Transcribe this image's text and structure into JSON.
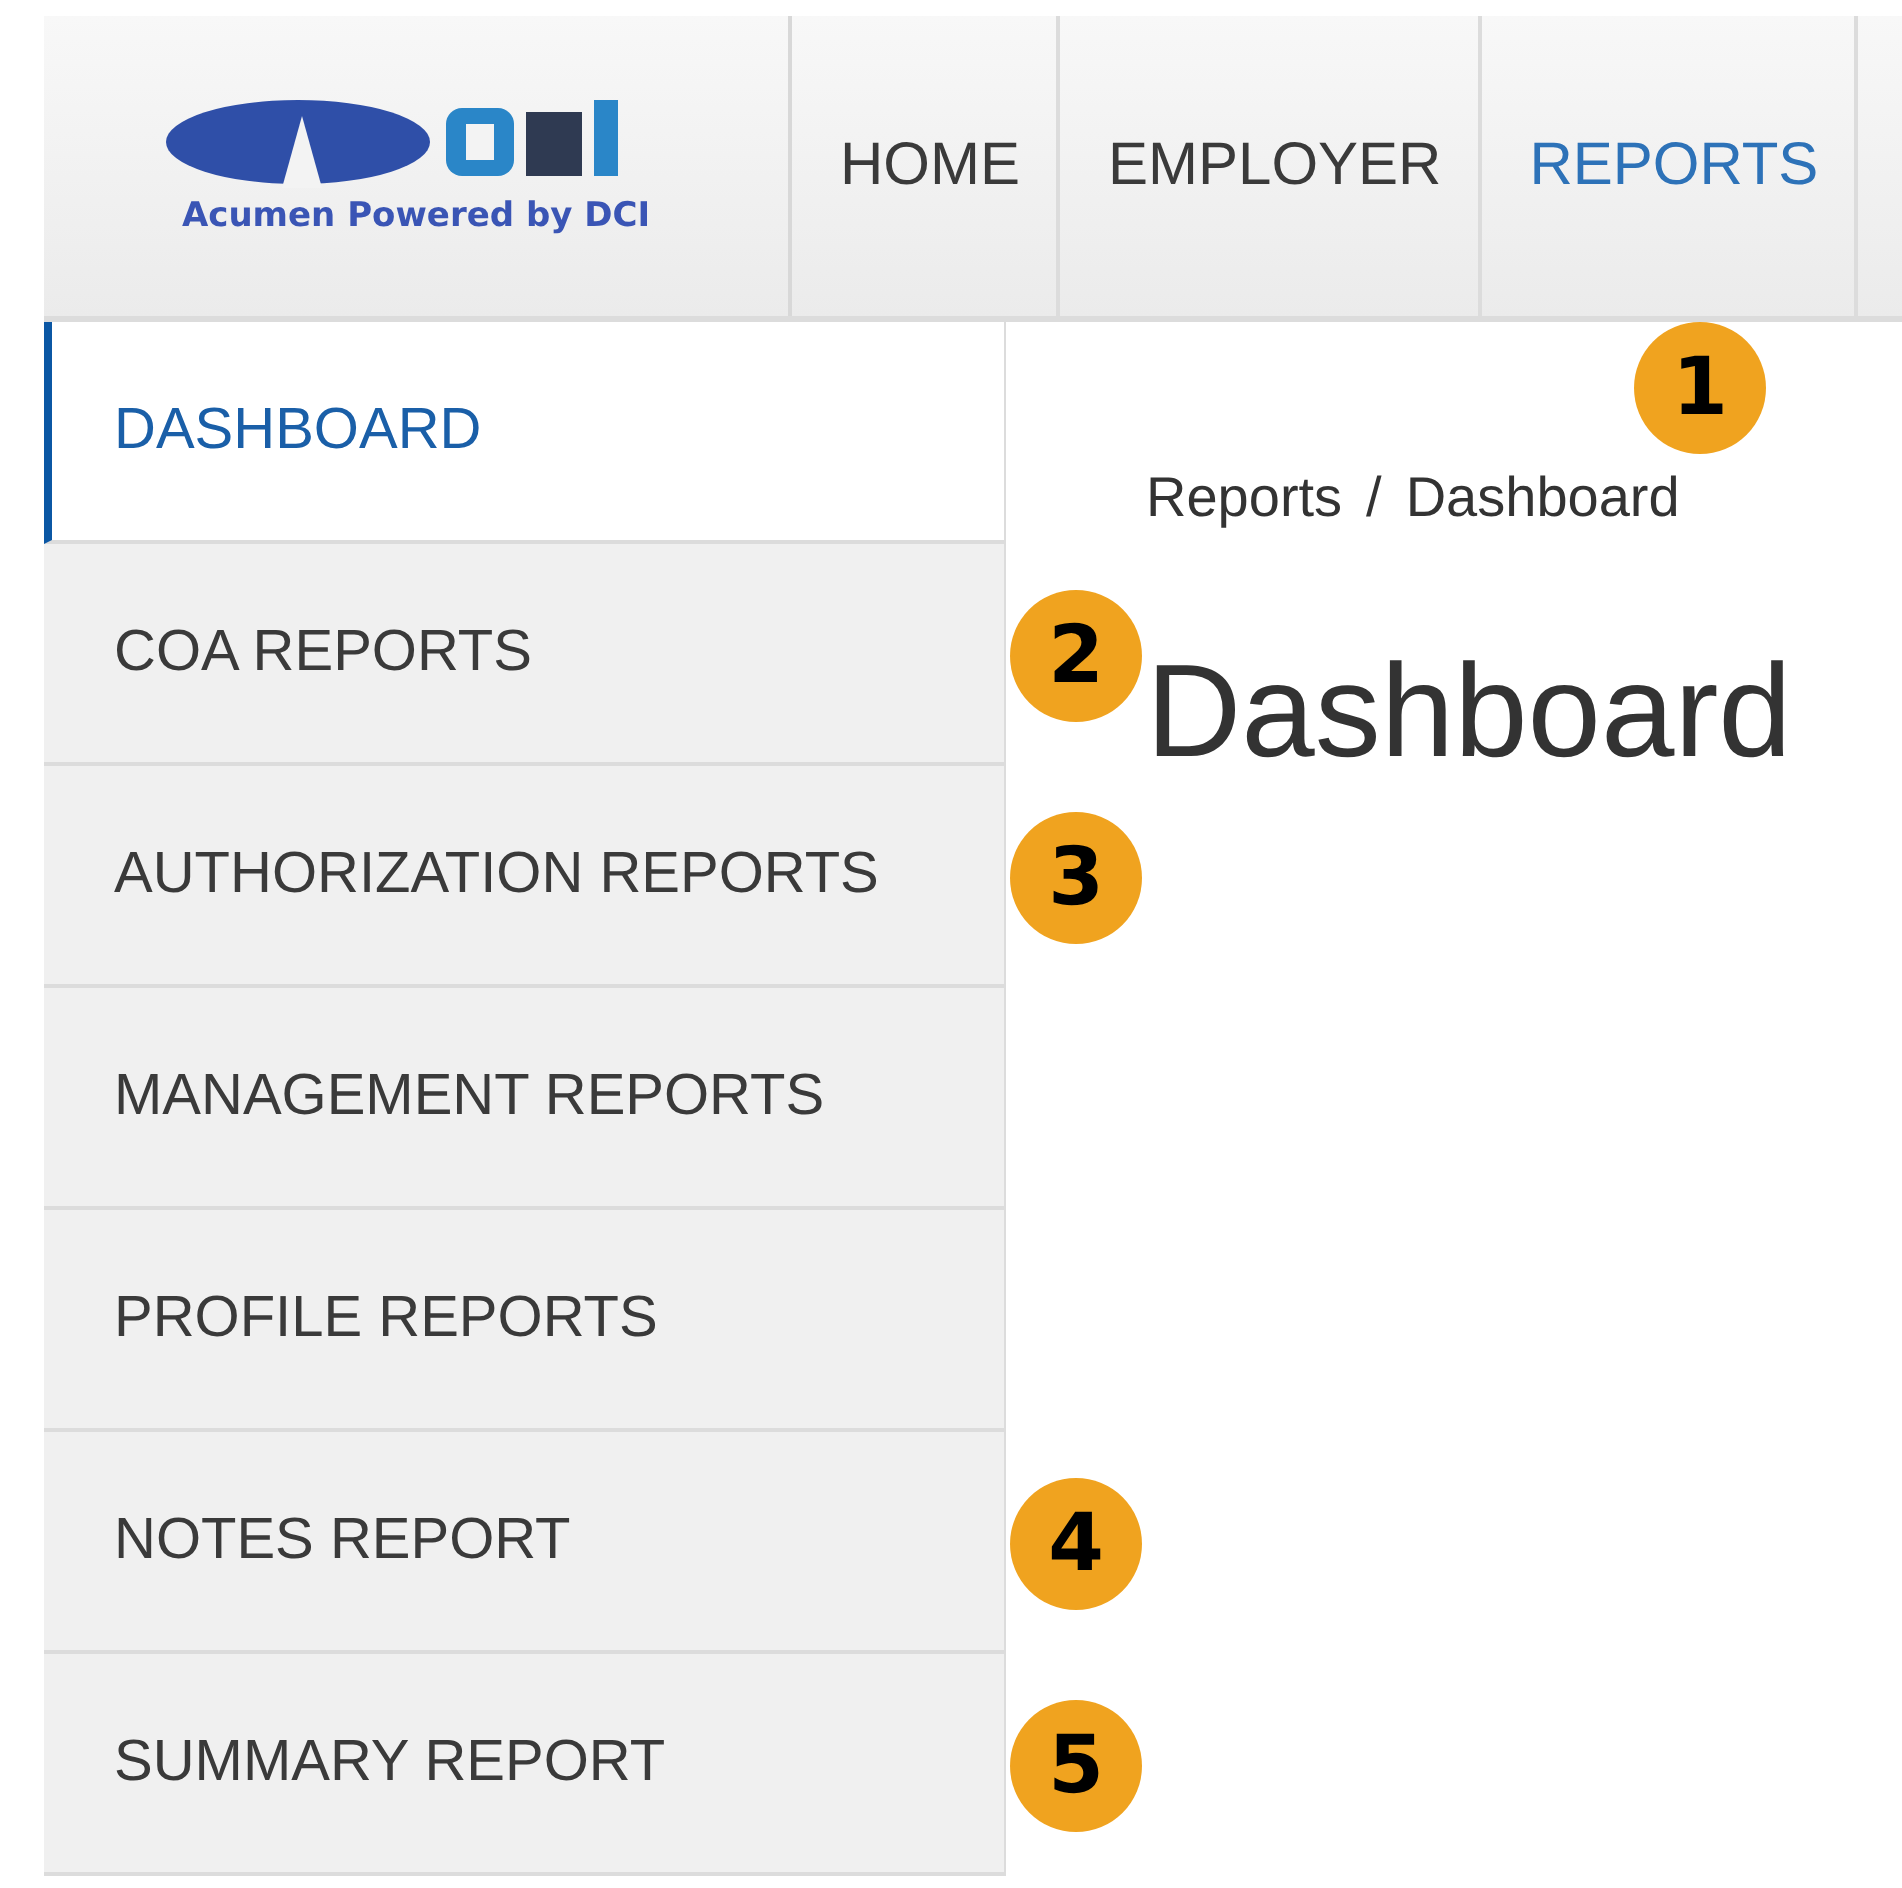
{
  "logo": {
    "tagline": "Acumen Powered by DCI"
  },
  "nav": [
    {
      "label": "HOME",
      "selected": false
    },
    {
      "label": "EMPLOYER",
      "selected": false
    },
    {
      "label": "REPORTS",
      "selected": true,
      "badge": "1"
    }
  ],
  "sidebar": {
    "items": [
      {
        "label": "DASHBOARD",
        "selected": true
      },
      {
        "label": "COA REPORTS",
        "selected": false,
        "badge": "2"
      },
      {
        "label": "AUTHORIZATION REPORTS",
        "selected": false,
        "badge": "3"
      },
      {
        "label": "MANAGEMENT REPORTS",
        "selected": false
      },
      {
        "label": "PROFILE REPORTS",
        "selected": false
      },
      {
        "label": "NOTES REPORT",
        "selected": false,
        "badge": "4"
      },
      {
        "label": "SUMMARY REPORT",
        "selected": false,
        "badge": "5"
      }
    ]
  },
  "breadcrumb": {
    "items": [
      "Reports",
      "Dashboard"
    ],
    "separator": "/"
  },
  "page_title": "Dashboard"
}
